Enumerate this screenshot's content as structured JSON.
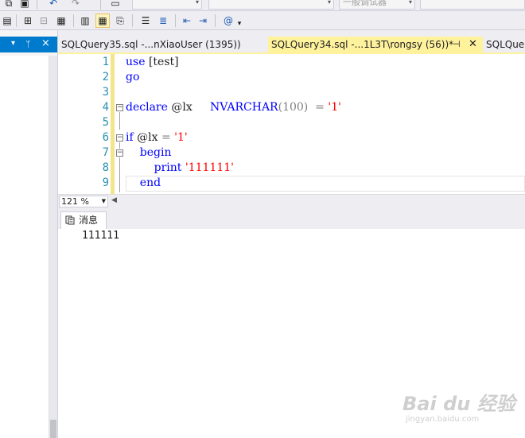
{
  "toolbar": {
    "combo_db": "",
    "combo_debugger": "一般调试器",
    "combo_solution": ""
  },
  "left_pane": {
    "dropdown_glyph": "▾",
    "pin_glyph": "ᛘ",
    "close_glyph": "×"
  },
  "tabs": [
    {
      "label": "SQLQuery35.sql -...nXiaoUser (1395))",
      "active": false
    },
    {
      "label": "SQLQuery34.sql -...1L3T\\rongsy (56))*",
      "active": true
    },
    {
      "label": "SQLQue",
      "active": false
    }
  ],
  "editor": {
    "line_numbers": [
      "1",
      "2",
      "3",
      "4",
      "5",
      "6",
      "7",
      "8",
      "9"
    ],
    "lines": {
      "l1_kw": "use",
      "l1_rest": " [test]",
      "l2_kw": "go",
      "l4_kw": "declare",
      "l4_var": " @lx     ",
      "l4_type": "NVARCHAR",
      "l4_paren": "(100)",
      "l4_eq": "  = ",
      "l4_str": "'1'",
      "l6_kw": "if",
      "l6_var": " @lx ",
      "l6_eq": "= ",
      "l6_str": "'1'",
      "l7_kw": "    begin",
      "l8_kw": "        print",
      "l8_str": " '111111'",
      "l9_kw": "    end"
    }
  },
  "zoom": {
    "level": "121 %"
  },
  "results": {
    "messages_tab": "消息",
    "output": "111111"
  },
  "watermark": {
    "logo": "Bai du 经验",
    "url": "jingyan.baidu.com"
  },
  "colors": {
    "accent": "#007acc",
    "active_tab": "#fff29d",
    "keyword": "#0000ff",
    "string": "#ff0000",
    "line_number": "#2b91af"
  }
}
